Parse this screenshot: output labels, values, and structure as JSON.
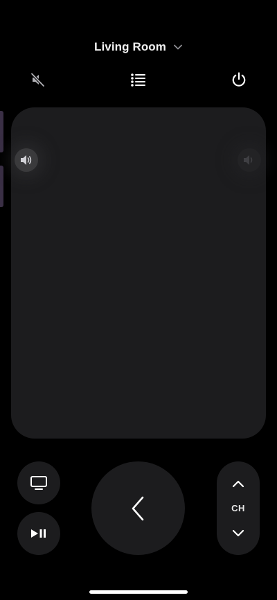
{
  "header": {
    "device_name": "Living Room"
  },
  "ch": {
    "label": "CH"
  },
  "icons": {
    "device_dropdown": "chevron-down-icon",
    "mute": "speaker-mute-icon",
    "guide": "list-icon",
    "power": "power-icon",
    "volume": "speaker-volume-icon",
    "tv": "tv-icon",
    "play_pause": "play-pause-icon",
    "back": "chevron-left-icon",
    "ch_up": "chevron-up-icon",
    "ch_down": "chevron-down-icon"
  },
  "colors": {
    "background": "#000000",
    "surface": "#1c1c1e",
    "foreground": "#ffffff",
    "edge_accent": "#3a2f45"
  }
}
